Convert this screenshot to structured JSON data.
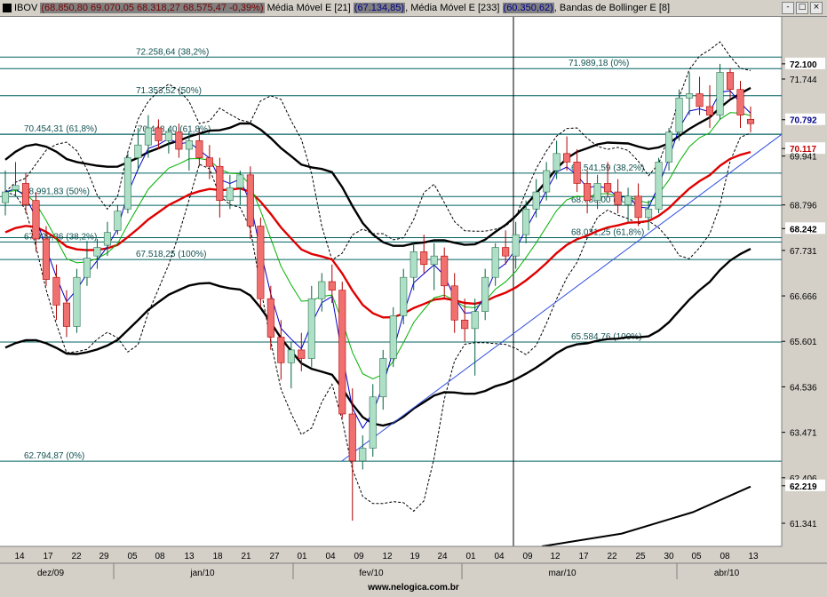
{
  "header": {
    "symbol": "IBOV",
    "ohlc": "(68.850,80 69.070,05 68.318,27 68.575,47 -0,39%)",
    "ma21_label": "Média Móvel E [21]",
    "ma21_value": "(67.134,85)",
    "ma233_label": "Média Móvel E [233]",
    "ma233_value": "(60.350,62)",
    "bollinger_label": "Bandas de Bollinger E [8]",
    "buttons": [
      "-",
      "□",
      "×"
    ]
  },
  "footer": {
    "site": "www.nelogica.com.br"
  },
  "colors": {
    "background": "#ffffff",
    "up": "#aee0c8",
    "down": "#f07070",
    "bb_outer": "#000000",
    "ma_red": "#e00000",
    "ma_blue": "#0000c8",
    "ma_green": "#00b000",
    "fib_line": "#006060",
    "trendline": "#3050e0"
  },
  "chart_data": {
    "type": "candlestick",
    "title": "IBOV",
    "y_range": [
      60.8,
      73.2
    ],
    "y_ticks": [
      "72.100",
      "71.744",
      "70.792",
      "70.117",
      "69.941",
      "68.796",
      "68.242",
      "67.731",
      "66.666",
      "65.601",
      "64.536",
      "63.471",
      "62.406",
      "62.219",
      "61.341"
    ],
    "highlighted_ticks": [
      {
        "label": "72.100",
        "value": 72.1,
        "style": "black"
      },
      {
        "label": "71.744",
        "value": 71.744,
        "style": "plain"
      },
      {
        "label": "70.792",
        "value": 70.792,
        "style": "blue"
      },
      {
        "label": "70.117",
        "value": 70.117,
        "style": "red"
      },
      {
        "label": "69.941",
        "value": 69.941,
        "style": "plain"
      },
      {
        "label": "68.242",
        "value": 68.242,
        "style": "black"
      },
      {
        "label": "62.219",
        "value": 62.219,
        "style": "black"
      }
    ],
    "x_day_ticks": [
      "14",
      "17",
      "22",
      "29",
      "05",
      "08",
      "13",
      "18",
      "21",
      "27",
      "01",
      "04",
      "09",
      "12",
      "19",
      "24",
      "01",
      "04",
      "09",
      "12",
      "17",
      "22",
      "25",
      "30",
      "05",
      "08",
      "13"
    ],
    "month_labels": [
      "dez/09",
      "jan/10",
      "fev/10",
      "mar/10",
      "abr/10"
    ],
    "fib_labels": [
      {
        "label": "72.258,64 (38,2%)",
        "value": 72.258
      },
      {
        "label": "71.989,18 (0%)",
        "value": 71.989
      },
      {
        "label": "71.353,52 (50%)",
        "value": 71.353
      },
      {
        "label": "70.454,31 (61,8%)",
        "value": 70.454
      },
      {
        "label": "70.448,40 (61,8%)",
        "value": 70.448
      },
      {
        "label": "69.541,59 (38,2%)",
        "value": 69.541
      },
      {
        "label": "68.991,83 (50%)",
        "value": 68.991
      },
      {
        "label": "68.786,00 (50%)",
        "value": 68.786
      },
      {
        "label": "68.031,25 (61,8%)",
        "value": 68.031
      },
      {
        "label": "67.929,36 (38,2%)",
        "value": 67.929
      },
      {
        "label": "67.518,25 (100%)",
        "value": 67.518
      },
      {
        "label": "65.584,76 (100%)",
        "value": 65.584
      },
      {
        "label": "62.794,87 (0%)",
        "value": 62.794
      }
    ],
    "candles": [
      {
        "o": 68.85,
        "h": 69.6,
        "l": 68.55,
        "c": 69.1
      },
      {
        "o": 69.15,
        "h": 69.8,
        "l": 69.0,
        "c": 69.25
      },
      {
        "o": 69.3,
        "h": 69.55,
        "l": 68.6,
        "c": 68.8
      },
      {
        "o": 68.9,
        "h": 69.1,
        "l": 67.7,
        "c": 68.0
      },
      {
        "o": 68.0,
        "h": 68.3,
        "l": 66.9,
        "c": 67.05
      },
      {
        "o": 67.1,
        "h": 67.4,
        "l": 66.1,
        "c": 66.45
      },
      {
        "o": 66.5,
        "h": 66.8,
        "l": 65.7,
        "c": 65.95
      },
      {
        "o": 65.95,
        "h": 67.3,
        "l": 65.8,
        "c": 67.1
      },
      {
        "o": 67.1,
        "h": 67.95,
        "l": 66.9,
        "c": 67.55
      },
      {
        "o": 67.6,
        "h": 68.0,
        "l": 67.3,
        "c": 67.8
      },
      {
        "o": 67.85,
        "h": 68.4,
        "l": 67.6,
        "c": 68.15
      },
      {
        "o": 68.2,
        "h": 68.8,
        "l": 68.1,
        "c": 68.65
      },
      {
        "o": 68.7,
        "h": 70.0,
        "l": 68.6,
        "c": 69.9
      },
      {
        "o": 69.9,
        "h": 70.6,
        "l": 69.6,
        "c": 70.2
      },
      {
        "o": 70.2,
        "h": 70.9,
        "l": 69.9,
        "c": 70.6
      },
      {
        "o": 70.6,
        "h": 70.8,
        "l": 70.1,
        "c": 70.3
      },
      {
        "o": 70.3,
        "h": 70.6,
        "l": 70.0,
        "c": 70.5
      },
      {
        "o": 70.5,
        "h": 70.7,
        "l": 69.9,
        "c": 70.1
      },
      {
        "o": 70.1,
        "h": 70.5,
        "l": 69.6,
        "c": 70.3
      },
      {
        "o": 70.3,
        "h": 70.6,
        "l": 69.7,
        "c": 69.9
      },
      {
        "o": 69.9,
        "h": 70.2,
        "l": 69.4,
        "c": 69.7
      },
      {
        "o": 69.7,
        "h": 69.9,
        "l": 68.5,
        "c": 68.9
      },
      {
        "o": 68.9,
        "h": 69.5,
        "l": 68.7,
        "c": 69.2
      },
      {
        "o": 69.2,
        "h": 69.6,
        "l": 68.8,
        "c": 69.5
      },
      {
        "o": 69.5,
        "h": 69.7,
        "l": 68.0,
        "c": 68.3
      },
      {
        "o": 68.3,
        "h": 68.5,
        "l": 66.4,
        "c": 66.6
      },
      {
        "o": 66.6,
        "h": 66.9,
        "l": 65.4,
        "c": 65.7
      },
      {
        "o": 65.7,
        "h": 66.1,
        "l": 64.7,
        "c": 65.1
      },
      {
        "o": 65.1,
        "h": 65.6,
        "l": 64.5,
        "c": 65.4
      },
      {
        "o": 65.4,
        "h": 65.8,
        "l": 64.9,
        "c": 65.2
      },
      {
        "o": 65.2,
        "h": 66.9,
        "l": 65.0,
        "c": 66.6
      },
      {
        "o": 66.6,
        "h": 67.2,
        "l": 66.3,
        "c": 67.0
      },
      {
        "o": 67.0,
        "h": 67.4,
        "l": 66.5,
        "c": 66.8
      },
      {
        "o": 66.8,
        "h": 67.0,
        "l": 63.8,
        "c": 63.9
      },
      {
        "o": 63.9,
        "h": 64.5,
        "l": 61.4,
        "c": 62.8
      },
      {
        "o": 62.8,
        "h": 63.4,
        "l": 62.6,
        "c": 63.1
      },
      {
        "o": 63.1,
        "h": 64.6,
        "l": 62.9,
        "c": 64.3
      },
      {
        "o": 64.3,
        "h": 65.4,
        "l": 64.0,
        "c": 65.2
      },
      {
        "o": 65.2,
        "h": 66.4,
        "l": 65.0,
        "c": 66.2
      },
      {
        "o": 66.2,
        "h": 67.3,
        "l": 66.0,
        "c": 67.1
      },
      {
        "o": 67.1,
        "h": 67.9,
        "l": 66.8,
        "c": 67.7
      },
      {
        "o": 67.7,
        "h": 68.1,
        "l": 67.2,
        "c": 67.4
      },
      {
        "o": 67.4,
        "h": 67.9,
        "l": 66.8,
        "c": 67.6
      },
      {
        "o": 67.6,
        "h": 67.8,
        "l": 66.6,
        "c": 66.9
      },
      {
        "o": 66.9,
        "h": 67.2,
        "l": 65.8,
        "c": 66.1
      },
      {
        "o": 66.1,
        "h": 66.6,
        "l": 65.6,
        "c": 65.9
      },
      {
        "o": 65.9,
        "h": 66.6,
        "l": 64.8,
        "c": 66.3
      },
      {
        "o": 66.3,
        "h": 67.3,
        "l": 66.1,
        "c": 67.1
      },
      {
        "o": 67.1,
        "h": 67.9,
        "l": 66.9,
        "c": 67.8
      },
      {
        "o": 67.8,
        "h": 68.2,
        "l": 67.4,
        "c": 67.6
      },
      {
        "o": 67.6,
        "h": 68.4,
        "l": 67.3,
        "c": 68.1
      },
      {
        "o": 68.1,
        "h": 68.9,
        "l": 67.9,
        "c": 68.7
      },
      {
        "o": 68.7,
        "h": 69.4,
        "l": 68.5,
        "c": 69.1
      },
      {
        "o": 69.1,
        "h": 69.8,
        "l": 68.9,
        "c": 69.6
      },
      {
        "o": 69.6,
        "h": 70.3,
        "l": 69.4,
        "c": 70.0
      },
      {
        "o": 70.0,
        "h": 70.4,
        "l": 69.6,
        "c": 69.8
      },
      {
        "o": 69.8,
        "h": 70.1,
        "l": 69.1,
        "c": 69.3
      },
      {
        "o": 69.3,
        "h": 69.6,
        "l": 68.6,
        "c": 68.9
      },
      {
        "o": 68.9,
        "h": 69.5,
        "l": 68.7,
        "c": 69.3
      },
      {
        "o": 69.3,
        "h": 69.8,
        "l": 69.0,
        "c": 69.1
      },
      {
        "o": 69.1,
        "h": 69.4,
        "l": 68.6,
        "c": 68.8
      },
      {
        "o": 68.8,
        "h": 69.2,
        "l": 68.4,
        "c": 69.0
      },
      {
        "o": 69.0,
        "h": 69.3,
        "l": 68.3,
        "c": 68.5
      },
      {
        "o": 68.5,
        "h": 68.9,
        "l": 68.2,
        "c": 68.7
      },
      {
        "o": 68.7,
        "h": 69.9,
        "l": 68.6,
        "c": 69.8
      },
      {
        "o": 69.8,
        "h": 70.6,
        "l": 69.6,
        "c": 70.5
      },
      {
        "o": 70.5,
        "h": 71.5,
        "l": 70.3,
        "c": 71.3
      },
      {
        "o": 71.3,
        "h": 71.9,
        "l": 70.9,
        "c": 71.4
      },
      {
        "o": 71.4,
        "h": 71.8,
        "l": 70.9,
        "c": 71.1
      },
      {
        "o": 71.1,
        "h": 71.6,
        "l": 70.6,
        "c": 70.9
      },
      {
        "o": 70.9,
        "h": 72.1,
        "l": 70.8,
        "c": 71.9
      },
      {
        "o": 71.9,
        "h": 72.0,
        "l": 71.3,
        "c": 71.5
      },
      {
        "o": 71.5,
        "h": 71.7,
        "l": 70.6,
        "c": 70.9
      },
      {
        "o": 70.8,
        "h": 71.1,
        "l": 70.5,
        "c": 70.7
      }
    ]
  }
}
